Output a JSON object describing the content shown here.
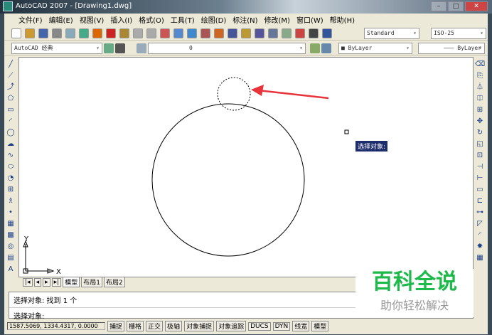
{
  "window": {
    "title": "AutoCAD 2007 - [Drawing1.dwg]"
  },
  "menu": [
    "文件(F)",
    "编辑(E)",
    "视图(V)",
    "插入(I)",
    "格式(O)",
    "工具(T)",
    "绘图(D)",
    "标注(N)",
    "修改(M)",
    "窗口(W)",
    "帮助(H)"
  ],
  "toolbar": {
    "text_style": "Standard",
    "dim_style": "ISO-25",
    "workspace": "AutoCAD 经典",
    "layer": "0",
    "color": "ByLayer",
    "linetype": "ByLayer"
  },
  "canvas": {
    "tooltip": "选择对象:",
    "ucs_x": "X",
    "ucs_y": "Y",
    "arrow_color": "#e8333a"
  },
  "tabs": [
    "模型",
    "布局1",
    "布局2"
  ],
  "command": {
    "line1": "选择对象: 找到 1 个",
    "line2": "选择对象:"
  },
  "status": {
    "coords": "1587.5069, 1334.4317, 0.0000",
    "buttons": [
      "捕捉",
      "栅格",
      "正交",
      "极轴",
      "对象捕捉",
      "对象追踪",
      "DUCS",
      "DYN",
      "线宽",
      "模型"
    ]
  },
  "watermark": {
    "title": "百科全说",
    "subtitle": "助你轻松解决",
    "color": "#1db94a"
  }
}
